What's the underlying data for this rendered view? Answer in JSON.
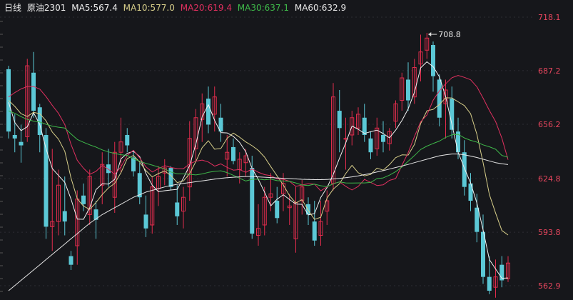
{
  "header": {
    "period": "日线",
    "symbol": "原油2301",
    "ma": [
      {
        "label": "MA5:",
        "value": "567.4",
        "color": "#f2f2f2"
      },
      {
        "label": "MA10:",
        "value": "577.0",
        "color": "#d8cf8a"
      },
      {
        "label": "MA20:",
        "value": "619.4",
        "color": "#e0305f"
      },
      {
        "label": "MA30:",
        "value": "637.1",
        "color": "#3fb94a"
      },
      {
        "label": "MA60:",
        "value": "632.9",
        "color": "#e6e6e6"
      }
    ]
  },
  "colors": {
    "up": "#e02c4c",
    "down": "#5bc8d6",
    "axis_text": "#e8465e",
    "background": "#16171b",
    "grid": "#2c2d33"
  },
  "chart_data": {
    "type": "candlestick",
    "y_ticks": [
      "718.1",
      "687.2",
      "656.2",
      "624.8",
      "593.8",
      "562.9"
    ],
    "ylim": [
      558,
      722
    ],
    "high_marker": "708.8",
    "candles": [
      [
        688,
        690,
        648,
        652
      ],
      [
        650,
        662,
        640,
        648
      ],
      [
        646,
        656,
        634,
        644
      ],
      [
        649,
        694,
        646,
        690
      ],
      [
        686,
        698,
        660,
        664
      ],
      [
        666,
        668,
        640,
        650
      ],
      [
        650,
        654,
        590,
        597
      ],
      [
        597,
        642,
        583,
        600
      ],
      [
        600,
        630,
        592,
        621
      ],
      [
        606,
        626,
        592,
        600
      ],
      [
        580,
        583,
        572,
        575
      ],
      [
        586,
        618,
        575,
        613
      ],
      [
        615,
        622,
        606,
        610
      ],
      [
        604,
        630,
        598,
        626
      ],
      [
        607,
        612,
        590,
        601
      ],
      [
        621,
        640,
        610,
        633
      ],
      [
        633,
        642,
        620,
        628
      ],
      [
        614,
        646,
        605,
        640
      ],
      [
        640,
        660,
        628,
        646
      ],
      [
        650,
        654,
        640,
        644
      ],
      [
        637,
        641,
        626,
        629
      ],
      [
        628,
        634,
        610,
        614
      ],
      [
        604,
        615,
        591,
        596
      ],
      [
        598,
        626,
        593,
        620
      ],
      [
        619,
        632,
        609,
        626
      ],
      [
        628,
        636,
        621,
        631
      ],
      [
        631,
        632,
        618,
        620
      ],
      [
        611,
        621,
        598,
        603
      ],
      [
        606,
        620,
        596,
        614
      ],
      [
        620,
        658,
        612,
        648
      ],
      [
        642,
        665,
        635,
        660
      ],
      [
        659,
        674,
        646,
        668
      ],
      [
        671,
        678,
        651,
        656
      ],
      [
        662,
        678,
        652,
        672
      ],
      [
        660,
        668,
        646,
        652
      ],
      [
        636,
        650,
        626,
        640
      ],
      [
        643,
        648,
        633,
        635
      ],
      [
        630,
        640,
        622,
        636
      ],
      [
        634,
        642,
        626,
        638
      ],
      [
        631,
        638,
        590,
        593
      ],
      [
        592,
        610,
        586,
        596
      ],
      [
        598,
        620,
        592,
        614
      ],
      [
        614,
        628,
        606,
        616
      ],
      [
        612,
        620,
        599,
        602
      ],
      [
        616,
        628,
        606,
        622
      ],
      [
        608,
        616,
        598,
        609
      ],
      [
        590,
        620,
        582,
        611
      ],
      [
        612,
        624,
        604,
        620
      ],
      [
        610,
        614,
        598,
        604
      ],
      [
        600,
        612,
        586,
        589
      ],
      [
        592,
        612,
        586,
        600
      ],
      [
        606,
        618,
        598,
        612
      ],
      [
        622,
        680,
        618,
        672
      ],
      [
        664,
        676,
        640,
        654
      ],
      [
        648,
        660,
        630,
        648
      ],
      [
        650,
        664,
        644,
        660
      ],
      [
        654,
        666,
        650,
        662
      ],
      [
        660,
        668,
        646,
        650
      ],
      [
        648,
        652,
        636,
        640
      ],
      [
        642,
        660,
        638,
        654
      ],
      [
        650,
        658,
        640,
        646
      ],
      [
        645,
        654,
        641,
        652
      ],
      [
        658,
        670,
        654,
        668
      ],
      [
        670,
        686,
        664,
        683
      ],
      [
        682,
        692,
        664,
        670
      ],
      [
        672,
        694,
        668,
        689
      ],
      [
        691,
        708,
        681,
        698
      ],
      [
        699,
        709,
        694,
        706
      ],
      [
        702,
        704,
        675,
        684
      ],
      [
        682,
        685,
        655,
        660
      ],
      [
        668,
        682,
        648,
        676
      ],
      [
        671,
        678,
        648,
        653
      ],
      [
        652,
        660,
        636,
        640
      ],
      [
        640,
        647,
        615,
        620
      ],
      [
        622,
        628,
        606,
        612
      ],
      [
        608,
        616,
        588,
        594
      ],
      [
        594,
        604,
        564,
        568
      ],
      [
        568,
        580,
        558,
        560
      ],
      [
        562,
        578,
        556,
        568
      ],
      [
        575,
        580,
        562,
        566
      ],
      [
        567,
        580,
        565,
        576
      ]
    ],
    "ma_lines": [
      {
        "name": "MA5",
        "values": [
          668.9,
          657.2,
          652.5,
          654.8,
          662.9,
          656,
          642.1,
          630.6,
          626.6,
          622.6,
          613,
          601.4,
          601.3,
          608,
          618.4,
          621.8,
          621.6,
          624.4,
          636.2,
          639.4,
          640.6,
          637.5,
          627.8,
          621,
          617.2,
          617.8,
          618.2,
          618.6,
          625.1,
          632.4,
          644.8,
          660.6,
          667.5,
          658.4,
          651.4,
          651.2,
          649.2,
          645.7,
          640.3,
          630.6,
          624.4,
          616.9,
          609.1,
          612.9,
          615.5,
          612.7,
          610.1,
          609.9,
          603.8,
          604.6,
          613.9,
          619.6,
          627.2,
          636.6,
          645.4,
          655.2,
          653.3,
          650.9,
          651.9,
          652.8,
          650.8,
          648.4,
          652.8,
          658.4,
          665.1,
          674.7,
          688.8,
          692.3,
          689.5,
          683.6,
          672.2,
          656.1,
          640.1,
          630.8,
          622.3,
          610.7,
          595.1,
          578,
          572.6,
          567.2,
          567.4
        ]
      },
      {
        "name": "MA10",
        "values": [
          670,
          666.5,
          662.3,
          660.7,
          663.1,
          662.3,
          658.2,
          651.7,
          647.6,
          640.6,
          625.2,
          613.1,
          608.9,
          607,
          611,
          615.6,
          619.4,
          622.1,
          628.2,
          636.3,
          638.2,
          634.3,
          629.4,
          625.8,
          627.7,
          629.2,
          626.6,
          622.5,
          623.4,
          627.7,
          634.7,
          642.7,
          646.7,
          641.8,
          642.2,
          648.1,
          651.1,
          648.7,
          646,
          643.8,
          641.1,
          637.2,
          631.7,
          626.4,
          621.1,
          614.9,
          610.7,
          612.7,
          606.4,
          601.2,
          602.5,
          613.6,
          618.7,
          621.9,
          627.7,
          632.5,
          628.2,
          626.4,
          627.2,
          630.9,
          629.7,
          632.9,
          636.9,
          638.5,
          638.4,
          644.5,
          656.6,
          664,
          664.8,
          667.6,
          671.5,
          671.4,
          669.2,
          667,
          662.3,
          650.4,
          634,
          615.6,
          604.9,
          594.8,
          592.2
        ]
      },
      {
        "name": "MA20",
        "values": [
          672,
          674.5,
          676.6,
          678,
          678,
          676.5,
          672.2,
          667.1,
          662.5,
          656,
          644.6,
          635.4,
          630.8,
          627.3,
          629,
          632.4,
          630.2,
          627.3,
          631.6,
          638.2,
          641.2,
          636.8,
          631.6,
          628.6,
          630.5,
          632.3,
          631.2,
          630.6,
          630.5,
          633.3,
          634.9,
          635.5,
          634.4,
          632,
          633.3,
          631.3,
          629.7,
          630,
          628.4,
          630.4,
          628.5,
          627.1,
          626.5,
          624.6,
          624.4,
          623.2,
          620.3,
          621.1,
          621.8,
          621.6,
          617.7,
          620.1,
          621.8,
          622.9,
          620.3,
          618.2,
          620.3,
          624.3,
          622.6,
          620.8,
          621.2,
          623.8,
          624.8,
          632.5,
          639.8,
          649.1,
          657.6,
          661.6,
          670.1,
          675.5,
          679.6,
          683.1,
          684.4,
          683.3,
          681.9,
          677.9,
          671.3,
          664.2,
          657.8,
          648.2,
          635.7
        ]
      },
      {
        "name": "MA30",
        "values": [
          664,
          662.5,
          660.6,
          659,
          658,
          657.5,
          656.2,
          655.1,
          654.5,
          654,
          650.6,
          647.4,
          645.8,
          644.3,
          643,
          641.4,
          640.2,
          639.3,
          638.6,
          638.2,
          636.2,
          634.8,
          633.6,
          632.6,
          631.5,
          630.3,
          628.6,
          627.6,
          627.5,
          627.3,
          626.9,
          627.5,
          628.4,
          629,
          629.3,
          628.3,
          626.7,
          625,
          623.4,
          624.4,
          624.5,
          624.1,
          624.5,
          623.6,
          623.4,
          623.2,
          622.3,
          621.1,
          620.8,
          621.6,
          620.7,
          620.1,
          621.8,
          622.9,
          622.3,
          622.2,
          622.3,
          622.3,
          622.6,
          624.8,
          625.2,
          626.8,
          628.8,
          631.5,
          634.8,
          638.1,
          641.6,
          643.6,
          645.1,
          646.5,
          648.6,
          650.1,
          650.4,
          648.3,
          646.9,
          645.9,
          644.3,
          643.2,
          641.8,
          638.2,
          637.1
        ]
      },
      {
        "name": "MA60",
        "values": [
          560,
          563,
          566,
          569,
          572,
          575,
          578,
          581,
          584,
          587,
          590,
          593,
          596,
          599,
          601.5,
          604,
          606,
          608,
          610,
          612,
          614,
          615.5,
          617,
          618,
          619,
          620,
          620.8,
          621.5,
          622,
          622.5,
          623,
          623.5,
          624,
          624.5,
          625,
          625.3,
          625.6,
          625.8,
          626,
          626,
          625.8,
          625.6,
          625.4,
          625.2,
          625,
          624.8,
          624.6,
          624.4,
          624.3,
          624.2,
          624.2,
          624.3,
          624.6,
          624.9,
          625.3,
          625.8,
          626.4,
          627.1,
          627.8,
          628.6,
          629.4,
          630.3,
          631.2,
          632.1,
          633,
          634,
          635,
          636,
          637,
          638,
          638.5,
          639,
          639,
          638.5,
          637.8,
          637,
          636,
          635,
          634,
          633.4,
          632.9
        ]
      }
    ]
  }
}
